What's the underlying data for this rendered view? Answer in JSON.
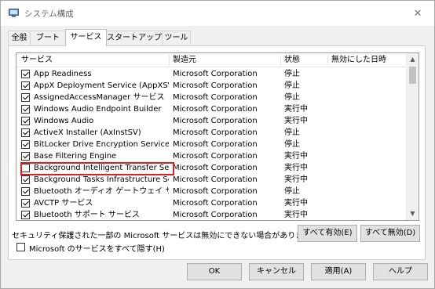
{
  "window": {
    "title": "システム構成",
    "close_glyph": "✕"
  },
  "tabs": [
    {
      "label": "全般"
    },
    {
      "label": "ブート"
    },
    {
      "label": "サービス",
      "active": true
    },
    {
      "label": "スタートアップ"
    },
    {
      "label": "ツール"
    }
  ],
  "table": {
    "headers": {
      "service": "サービス",
      "manufacturer": "製造元",
      "status": "状態",
      "disabled_date": "無効にした日時"
    },
    "rows": [
      {
        "name": "App Readiness",
        "maker": "Microsoft Corporation",
        "status": "停止",
        "checked": true
      },
      {
        "name": "AppX Deployment Service (AppXSVC)",
        "maker": "Microsoft Corporation",
        "status": "停止",
        "checked": true
      },
      {
        "name": "AssignedAccessManager サービス",
        "maker": "Microsoft Corporation",
        "status": "停止",
        "checked": true
      },
      {
        "name": "Windows Audio Endpoint Builder",
        "maker": "Microsoft Corporation",
        "status": "実行中",
        "checked": true
      },
      {
        "name": "Windows Audio",
        "maker": "Microsoft Corporation",
        "status": "実行中",
        "checked": true
      },
      {
        "name": "ActiveX Installer (AxInstSV)",
        "maker": "Microsoft Corporation",
        "status": "停止",
        "checked": true
      },
      {
        "name": "BitLocker Drive Encryption Service",
        "maker": "Microsoft Corporation",
        "status": "停止",
        "checked": true
      },
      {
        "name": "Base Filtering Engine",
        "maker": "Microsoft Corporation",
        "status": "実行中",
        "checked": true
      },
      {
        "name": "Background Intelligent Transfer Servi...",
        "maker": "Microsoft Corporation",
        "status": "実行中",
        "checked": false
      },
      {
        "name": "Background Tasks Infrastructure Serv...",
        "maker": "Microsoft Corporation",
        "status": "実行中",
        "checked": true
      },
      {
        "name": "Bluetooth オーディオ ゲートウェイ サービス",
        "maker": "Microsoft Corporation",
        "status": "停止",
        "checked": true
      },
      {
        "name": "AVCTP サービス",
        "maker": "Microsoft Corporation",
        "status": "実行中",
        "checked": true
      },
      {
        "name": "Bluetooth サポート サービス",
        "maker": "Microsoft Corporation",
        "status": "実行中",
        "checked": true
      }
    ],
    "highlighted_row_index": 8
  },
  "note": "セキュリティ保護された一部の Microsoft サービスは無効にできない場合があります。",
  "buttons": {
    "enable_all": "すべて有効(E)",
    "disable_all": "すべて無効(D)",
    "ok": "OK",
    "cancel": "キャンセル",
    "apply": "適用(A)",
    "help": "ヘルプ"
  },
  "hide_ms": {
    "label": "Microsoft のサービスをすべて隠す(H)",
    "checked": false
  },
  "colors": {
    "highlight_border": "#e02020"
  }
}
